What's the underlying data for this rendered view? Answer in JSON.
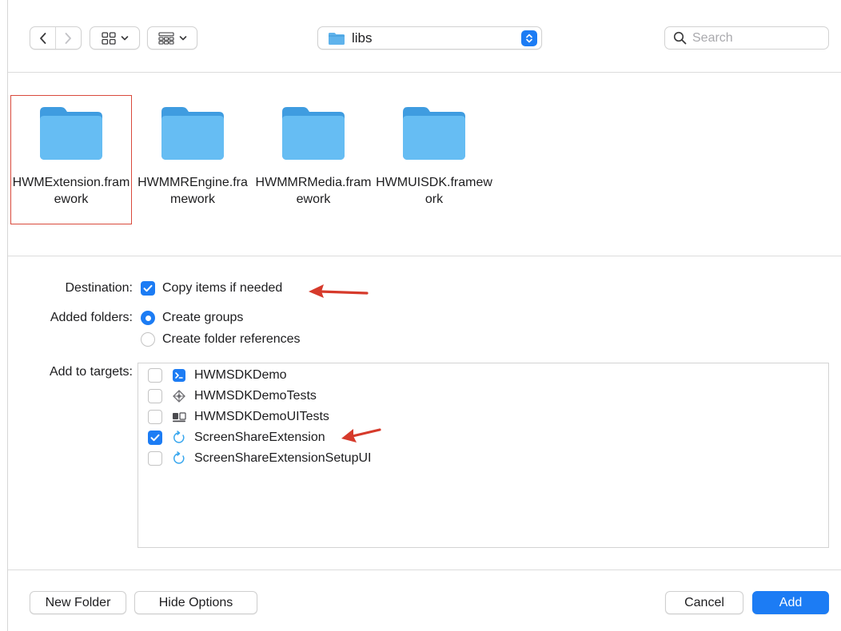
{
  "toolbar": {
    "back_icon": "chevron-left-icon",
    "forward_icon": "chevron-right-icon",
    "view_icon": "grid-view-icon",
    "group_icon": "group-by-icon",
    "path_folder": "libs",
    "search_placeholder": "Search"
  },
  "files": [
    {
      "name": "HWMExtension.framework",
      "selected": true
    },
    {
      "name": "HWMMREngine.framework",
      "selected": false
    },
    {
      "name": "HWMMRMedia.framework",
      "selected": false
    },
    {
      "name": "HWMUISDK.framework",
      "selected": false
    }
  ],
  "options": {
    "destination_label": "Destination:",
    "copy_items_label": "Copy items if needed",
    "copy_items_checked": true,
    "added_folders_label": "Added folders:",
    "create_groups_label": "Create groups",
    "create_groups_selected": true,
    "create_folder_refs_label": "Create folder references",
    "create_folder_refs_selected": false,
    "add_to_targets_label": "Add to targets:"
  },
  "targets": [
    {
      "name": "HWMSDKDemo",
      "checked": false,
      "icon": "app-target-icon"
    },
    {
      "name": "HWMSDKDemoTests",
      "checked": false,
      "icon": "unit-test-target-icon"
    },
    {
      "name": "HWMSDKDemoUITests",
      "checked": false,
      "icon": "ui-test-target-icon"
    },
    {
      "name": "ScreenShareExtension",
      "checked": true,
      "icon": "extension-target-icon"
    },
    {
      "name": "ScreenShareExtensionSetupUI",
      "checked": false,
      "icon": "extension-target-icon"
    }
  ],
  "buttons": {
    "new_folder": "New Folder",
    "hide_options": "Hide Options",
    "cancel": "Cancel",
    "add": "Add"
  },
  "colors": {
    "accent": "#1c7cf4",
    "folder": "#5fb3ec",
    "annotation": "#d63a2b"
  }
}
